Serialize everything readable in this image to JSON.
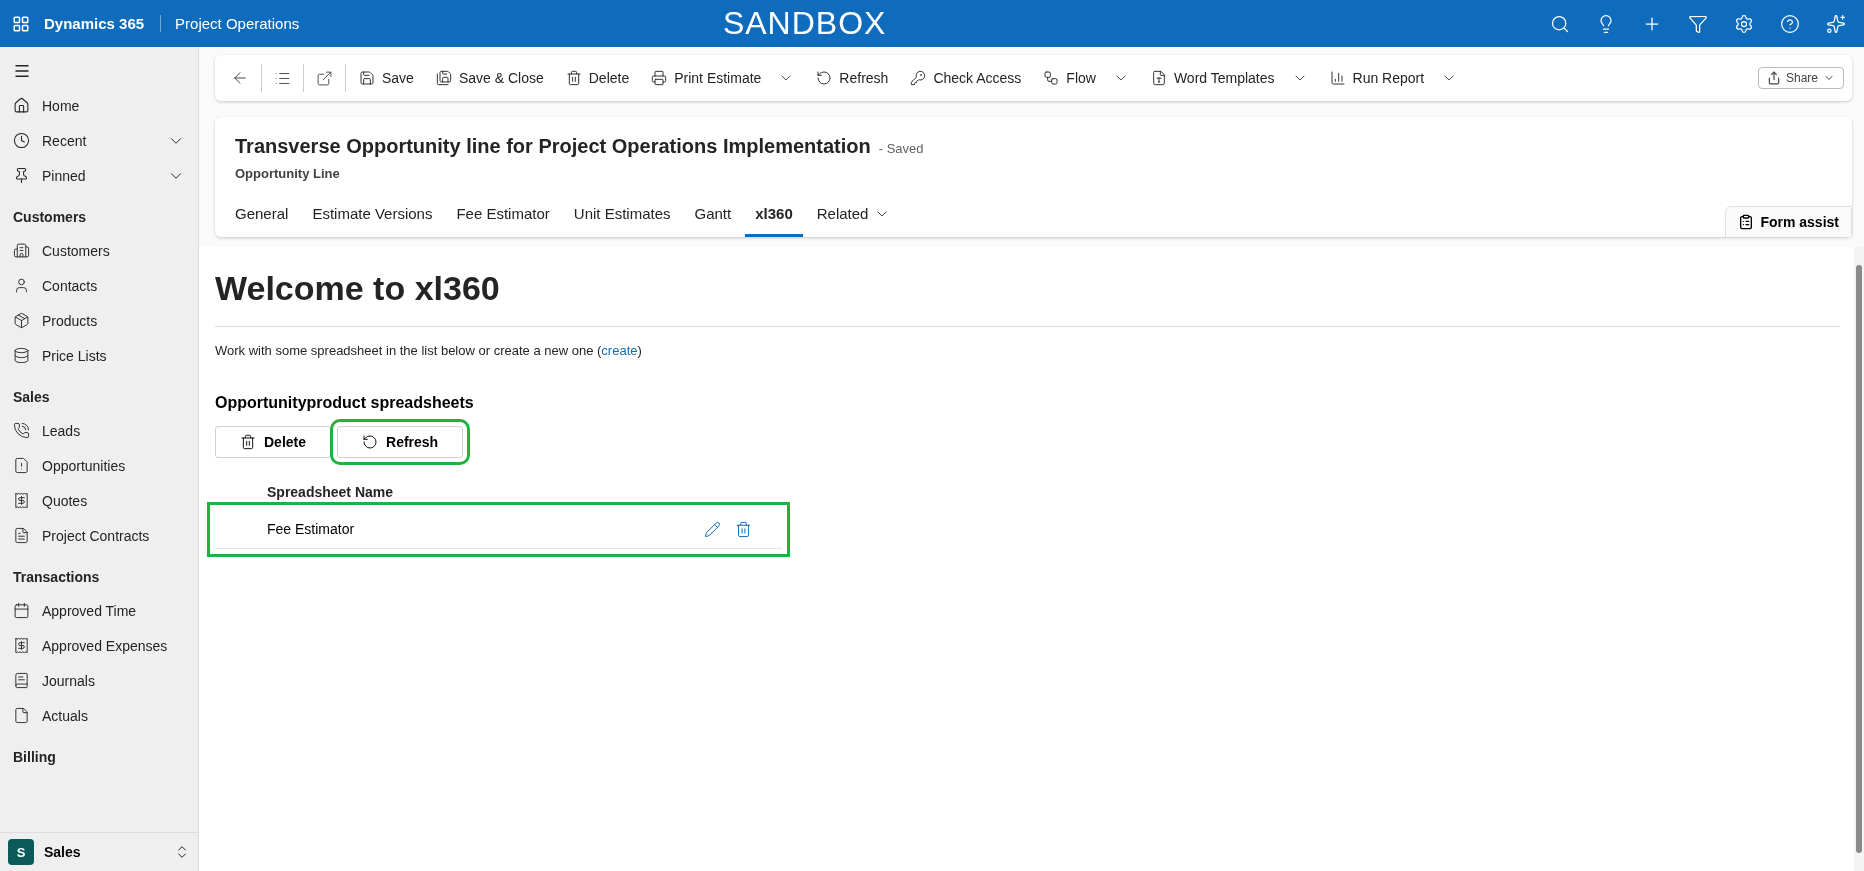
{
  "top_bar": {
    "brand": "Dynamics 365",
    "app": "Project Operations",
    "environment": "SANDBOX"
  },
  "sidebar": {
    "items": [
      {
        "label": "Home",
        "kind": "link"
      },
      {
        "label": "Recent",
        "kind": "expandable",
        "expanded": false
      },
      {
        "label": "Pinned",
        "kind": "expandable",
        "expanded": false
      }
    ],
    "groups": [
      {
        "title": "Customers",
        "items": [
          "Customers",
          "Contacts",
          "Products",
          "Price Lists"
        ]
      },
      {
        "title": "Sales",
        "items": [
          "Leads",
          "Opportunities",
          "Quotes",
          "Project Contracts"
        ]
      },
      {
        "title": "Transactions",
        "items": [
          "Approved Time",
          "Approved Expenses",
          "Journals",
          "Actuals"
        ]
      },
      {
        "title": "Billing"
      }
    ],
    "area": {
      "badge": "S",
      "label": "Sales"
    }
  },
  "command_bar": {
    "commands": [
      {
        "label": "Save",
        "dropdown": false
      },
      {
        "label": "Save & Close",
        "dropdown": false
      },
      {
        "label": "Delete",
        "dropdown": false
      },
      {
        "label": "Print Estimate",
        "dropdown": true
      },
      {
        "label": "Refresh",
        "dropdown": false
      },
      {
        "label": "Check Access",
        "dropdown": false
      },
      {
        "label": "Flow",
        "dropdown": true
      },
      {
        "label": "Word Templates",
        "dropdown": true
      },
      {
        "label": "Run Report",
        "dropdown": true
      }
    ],
    "share": "Share"
  },
  "record": {
    "title": "Transverse Opportunity line for Project Operations Implementation",
    "status": "- Saved",
    "entity": "Opportunity Line",
    "tabs": [
      {
        "label": "General",
        "selected": false,
        "dropdown": false
      },
      {
        "label": "Estimate Versions",
        "selected": false,
        "dropdown": false
      },
      {
        "label": "Fee Estimator",
        "selected": false,
        "dropdown": false
      },
      {
        "label": "Unit Estimates",
        "selected": false,
        "dropdown": false
      },
      {
        "label": "Gantt",
        "selected": false,
        "dropdown": false
      },
      {
        "label": "xl360",
        "selected": true,
        "dropdown": false
      },
      {
        "label": "Related",
        "selected": false,
        "dropdown": true
      }
    ],
    "form_assist": "Form assist"
  },
  "content": {
    "heading": "Welcome to xl360",
    "description_before": "Work with some spreadsheet in the list below or create a new one (",
    "description_link": "create",
    "description_after": ")",
    "section_title": "Opportunityproduct spreadsheets",
    "buttons": [
      {
        "label": "Delete",
        "highlighted": false
      },
      {
        "label": "Refresh",
        "highlighted": true
      }
    ],
    "column": "Spreadsheet Name",
    "rows": [
      {
        "name": "Fee Estimator",
        "highlighted": true
      }
    ]
  }
}
